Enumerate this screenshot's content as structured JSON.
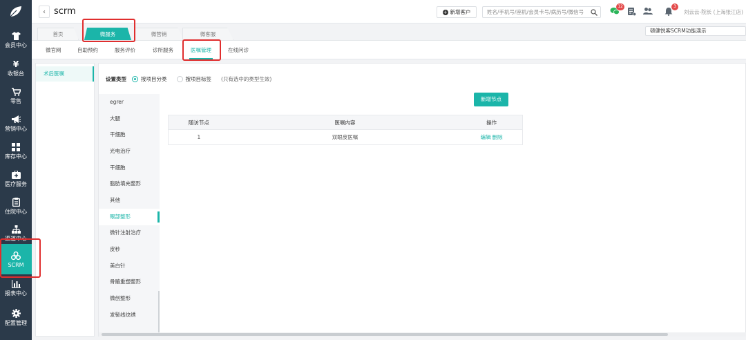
{
  "colors": {
    "sidebar_bg": "#2b3a4a",
    "accent": "#1bb5a9",
    "highlight": "#e02e2e",
    "badge": "#e34b4b"
  },
  "sidebar": {
    "logo_icon": "leaf-logo-icon",
    "items": [
      {
        "label": "会员中心",
        "icon": "shirt-icon"
      },
      {
        "label": "收银台",
        "icon": "yen-icon"
      },
      {
        "label": "零售",
        "icon": "cart-icon"
      },
      {
        "label": "营销中心",
        "icon": "megaphone-icon"
      },
      {
        "label": "库存中心",
        "icon": "grid-icon"
      },
      {
        "label": "医疗服务",
        "icon": "medical-kit-icon"
      },
      {
        "label": "住院中心",
        "icon": "clipboard-icon"
      },
      {
        "label": "渠道中心",
        "icon": "org-chart-icon"
      },
      {
        "label": "SCRM",
        "icon": "scrm-icon",
        "active": true
      },
      {
        "label": "报表中心",
        "icon": "bar-chart-icon"
      },
      {
        "label": "配置管理",
        "icon": "gear-icon"
      }
    ]
  },
  "topbar": {
    "back_label": "‹",
    "title": "scrm",
    "new_customer_label": "新增客户",
    "search_placeholder": "姓名/手机号/座机/会员卡号/病历号/微信号",
    "badges": {
      "wechat": "12",
      "notifications": "3"
    },
    "user_info": "刘云云-院长 (上海张江店) ⌄"
  },
  "module_tabs": [
    {
      "label": "首页"
    },
    {
      "label": "微服务",
      "active": true
    },
    {
      "label": "微营销"
    },
    {
      "label": "微客服"
    }
  ],
  "demo_link": "顿健悦客SCRM功能演示",
  "sub_tabs": [
    {
      "label": "微官网"
    },
    {
      "label": "自助预约"
    },
    {
      "label": "服务评价"
    },
    {
      "label": "诊所服务"
    },
    {
      "label": "医嘱管理",
      "active": true
    },
    {
      "label": "在线问诊"
    }
  ],
  "left_panel": {
    "items": [
      {
        "label": "术后医嘱",
        "active": true
      }
    ]
  },
  "settings": {
    "label": "设置类型",
    "options": [
      {
        "label": "按项目分类",
        "checked": true
      },
      {
        "label": "按项目标签",
        "checked": false
      }
    ],
    "note": "(只有选中的类型生效)"
  },
  "categories": [
    {
      "label": "egrer"
    },
    {
      "label": "大腿"
    },
    {
      "label": "干细胞"
    },
    {
      "label": "光电治疗"
    },
    {
      "label": "干细胞"
    },
    {
      "label": "脂肪填充整形"
    },
    {
      "label": "其他"
    },
    {
      "label": "眼部整形",
      "active": true
    },
    {
      "label": "微针注射治疗"
    },
    {
      "label": "皮秒"
    },
    {
      "label": "美白针"
    },
    {
      "label": "骨骼重塑整形"
    },
    {
      "label": "微创整形"
    },
    {
      "label": "发髻线纹绣"
    }
  ],
  "add_node_label": "新增节点",
  "table": {
    "headers": [
      "随访节点",
      "医嘱内容",
      "操作"
    ],
    "rows": [
      {
        "node": "1",
        "content": "双眼皮医嘱",
        "edit": "编辑",
        "delete": "删除"
      }
    ]
  }
}
